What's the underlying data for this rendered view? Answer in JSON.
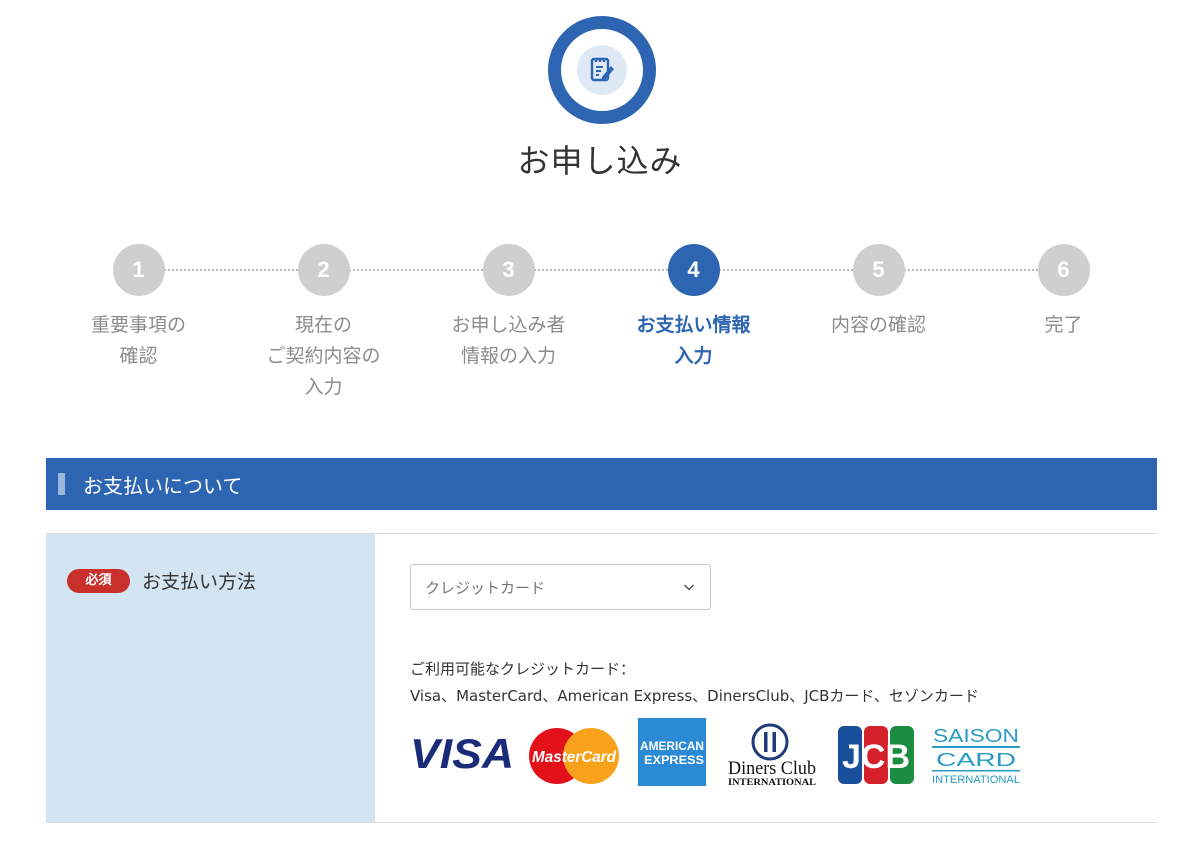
{
  "header": {
    "title": "お申し込み",
    "icon": "edit-document-icon"
  },
  "stepper": {
    "steps": [
      {
        "number": "1",
        "label": "重要事項の\n確認",
        "active": false
      },
      {
        "number": "2",
        "label": "現在の\nご契約内容の\n入力",
        "active": false
      },
      {
        "number": "3",
        "label": "お申し込み者\n情報の入力",
        "active": false
      },
      {
        "number": "4",
        "label": "お支払い情報\n入力",
        "active": true
      },
      {
        "number": "5",
        "label": "内容の確認",
        "active": false
      },
      {
        "number": "6",
        "label": "完了",
        "active": false
      }
    ]
  },
  "section": {
    "title": "お支払いについて"
  },
  "payment": {
    "required_badge": "必須",
    "label": "お支払い方法",
    "select_value": "クレジットカード",
    "cards_label": "ご利用可能なクレジットカード：",
    "cards_list": "Visa、MasterCard、American Express、DinersClub、JCBカード、セゾンカード",
    "logos": {
      "visa": "VISA",
      "mastercard": "MasterCard",
      "amex_line1": "AMERICAN",
      "amex_line2": "EXPRESS",
      "diners_line1": "Diners Club",
      "diners_line2": "INTERNATIONAL",
      "jcb": "JCB",
      "saison_line1": "SAISON",
      "saison_line2": "CARD",
      "saison_line3": "INTERNATIONAL"
    }
  },
  "colors": {
    "brand_blue": "#2d65b2",
    "label_bg": "#d3e4f3",
    "required_red": "#c9302c",
    "inactive_gray": "#cfcfcf"
  }
}
